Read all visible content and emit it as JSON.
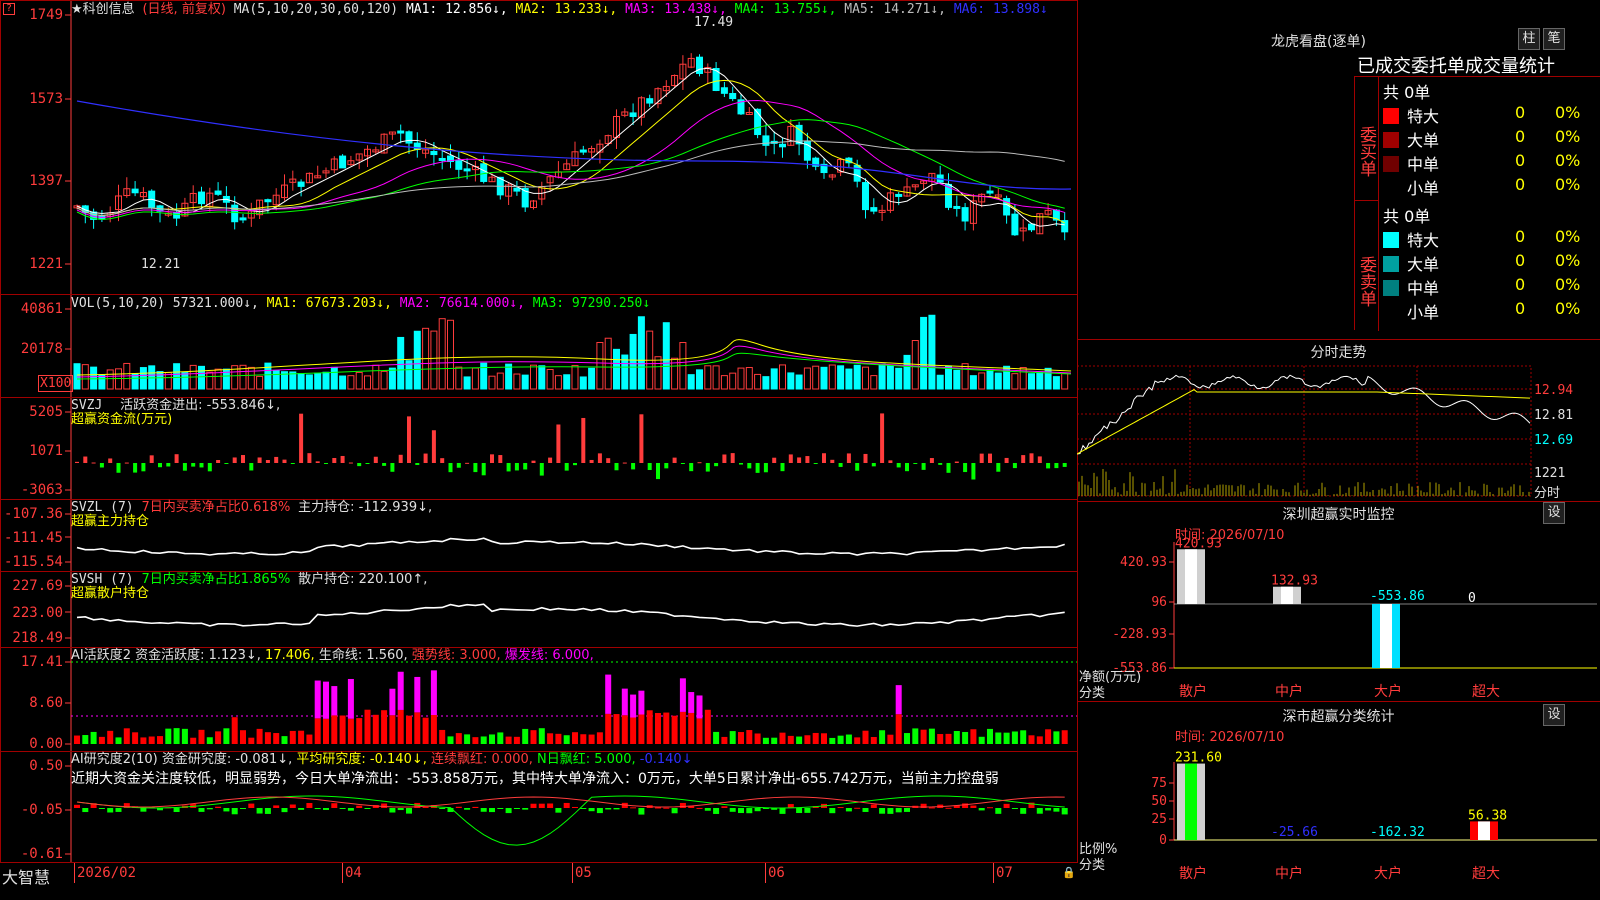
{
  "colors": {
    "up": "#ff3c3c",
    "down": "#00ffff",
    "grid": "#a00000",
    "ma_white": "#ffffff",
    "ma_yellow": "#ffff00",
    "ma_magenta": "#ff00ff",
    "ma_green": "#00ff00",
    "ma_gray": "#bbbbbb",
    "ma_blue": "#3030ff"
  },
  "main": {
    "stock_name": "★科创信息",
    "period_label": "(日线, 前复权)",
    "ma_params": "MA(5,10,20,30,60,120)",
    "ma_values": [
      {
        "label": "MA1: 12.856↓,",
        "color": "#ffffff"
      },
      {
        "label": "MA2: 13.233↓,",
        "color": "#ffff00"
      },
      {
        "label": "MA3: 13.438↓,",
        "color": "#ff00ff"
      },
      {
        "label": "MA4: 13.755↓,",
        "color": "#00ff00"
      },
      {
        "label": "MA5: 14.271↓,",
        "color": "#bbbbbb"
      },
      {
        "label": "MA6: 13.898↓",
        "color": "#3030ff"
      }
    ],
    "y_axis": [
      "1749",
      "1573",
      "1397",
      "1221"
    ],
    "high_marker": "17.49",
    "low_marker": "12.21"
  },
  "vol": {
    "title": "VOL(5,10,20)",
    "value": "57321.000↓,",
    "ma1": "MA1: 67673.203↓,",
    "ma2": "MA2: 76614.000↓,",
    "ma3": "MA3: 97290.250↓",
    "y_axis": [
      "40861",
      "20178"
    ],
    "unit": "X100"
  },
  "svzj": {
    "title": "SVZJ",
    "label": "活跃资金进出: -553.846↓,",
    "subtitle": "超赢资金流(万元)",
    "y_axis": [
      "5205",
      "1071",
      "-3063"
    ]
  },
  "svzl": {
    "title": "SVZL (7)",
    "ratio": "7日内买卖净占比0.618%",
    "hold": "主力持仓: -112.939↓,",
    "subtitle": "超赢主力持仓",
    "y_axis": [
      "-107.36",
      "-111.45",
      "-115.54"
    ]
  },
  "svsh": {
    "title": "SVSH (7)",
    "ratio": "7日内买卖净占比1.865%",
    "hold": "散户持仓: 220.100↑,",
    "subtitle": "超赢散户持仓",
    "y_axis": [
      "227.69",
      "223.00",
      "218.49"
    ]
  },
  "ai_act": {
    "title": "AI活跃度2",
    "v1": "资金活跃度: 1.123↓,",
    "v2": "17.406,",
    "v3": "生命线: 1.560,",
    "v4": "强势线: 3.000,",
    "v5": "爆发线: 6.000,",
    "y_axis": [
      "17.41",
      "8.60",
      "0.00"
    ]
  },
  "ai_res": {
    "title": "AI研究度2(10)",
    "v1": "资金研究度: -0.081↓,",
    "v2": "平均研究度: -0.140↓,",
    "v3": "连续飘红: 0.000,",
    "v4": "N日飘红: 5.000,",
    "v5": "-0.140↓",
    "summary": "近期大资金关注度较低，明显弱势，今日大单净流出：-553.858万元，其中特大单净流入：0万元，大单5日累计净出-655.742万元，当前主力控盘弱",
    "y_axis": [
      "0.50",
      "-0.05",
      "-0.61"
    ]
  },
  "xaxis": {
    "logo": "大智慧",
    "labels": [
      "2026/02",
      "04",
      "05",
      "06",
      "07"
    ]
  },
  "lhb": {
    "title": "龙虎看盘(逐单)",
    "btn1": "柱",
    "btn2": "笔",
    "subtitle": "已成交委托单成交量统计",
    "buy_label": "委买单",
    "sell_label": "委卖单",
    "buy_total": "共 0单",
    "sell_total": "共 0单",
    "buy_rows": [
      {
        "name": "特大",
        "v1": "0",
        "v2": "0%",
        "color": "#ff0000"
      },
      {
        "name": "大单",
        "v1": "0",
        "v2": "0%",
        "color": "#a00000"
      },
      {
        "name": "中单",
        "v1": "0",
        "v2": "0%",
        "color": "#700000"
      },
      {
        "name": "小单",
        "v1": "0",
        "v2": "0%",
        "color": "#000000"
      }
    ],
    "sell_rows": [
      {
        "name": "特大",
        "v1": "0",
        "v2": "0%",
        "color": "#00ffff"
      },
      {
        "name": "大单",
        "v1": "0",
        "v2": "0%",
        "color": "#00a0a0"
      },
      {
        "name": "中单",
        "v1": "0",
        "v2": "0%",
        "color": "#008080"
      },
      {
        "name": "小单",
        "v1": "0",
        "v2": "0%",
        "color": "#000000"
      }
    ]
  },
  "intraday": {
    "title": "分时走势",
    "y_axis": [
      "12.94",
      "12.81",
      "12.69"
    ],
    "vol_label": "1221",
    "vol_unit": "分时"
  },
  "sz_monitor": {
    "title": "深圳超赢实时监控",
    "btn": "设",
    "time": "时间: 2026/07/10",
    "y_axis": [
      "420.93",
      "96",
      "-228.93",
      "-553.86"
    ],
    "ylabel1": "净额(万元)",
    "ylabel2": "分类",
    "categories": [
      "散户",
      "中户",
      "大户",
      "超大"
    ],
    "values": [
      420.93,
      132.93,
      -553.86,
      0
    ],
    "value_labels": [
      "420.93",
      "132.93",
      "-553.86",
      "0"
    ]
  },
  "sz_class": {
    "title": "深市超赢分类统计",
    "btn": "设",
    "time": "时间: 2026/07/10",
    "y_axis": [
      "75",
      "50",
      "25",
      "0"
    ],
    "ylabel1": "比例%",
    "ylabel2": "分类",
    "categories": [
      "散户",
      "中户",
      "大户",
      "超大"
    ],
    "values": [
      231.6,
      -25.66,
      -162.32,
      56.38
    ],
    "value_labels": [
      "231.60",
      "-25.66",
      "-162.32",
      "56.38"
    ]
  }
}
